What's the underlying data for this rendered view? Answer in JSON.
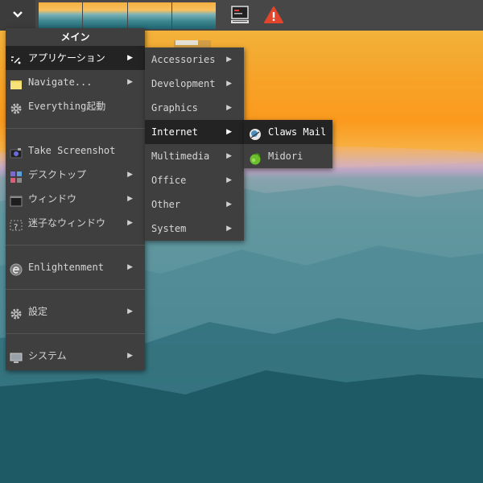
{
  "shelf": {
    "start_icon": "chevron-down-icon",
    "pager_desks": 4,
    "tray_icons": [
      "monitor-icon",
      "warning-icon"
    ]
  },
  "main_menu": {
    "title": "メイン",
    "items": [
      {
        "label": "アプリケーション",
        "icon": "applications-icon",
        "arrow": "▶"
      },
      {
        "label": "Navigate...",
        "icon": "folder-icon",
        "arrow": "▶"
      },
      {
        "label": "Everything起動",
        "icon": "gear-icon"
      },
      {
        "label": "Take Screenshot",
        "icon": "camera-icon"
      },
      {
        "label": "デスクトップ",
        "icon": "desktop-icon",
        "arrow": "▶"
      },
      {
        "label": "ウィンドウ",
        "icon": "window-icon",
        "arrow": "▶"
      },
      {
        "label": "迷子なウィンドウ",
        "icon": "lost-window-icon",
        "arrow": "▶"
      },
      {
        "label": "Enlightenment",
        "icon": "enlightenment-icon",
        "arrow": "▶"
      },
      {
        "label": "設定",
        "icon": "settings-gear-icon",
        "arrow": "▶"
      },
      {
        "label": "システム",
        "icon": "computer-icon",
        "arrow": "▶"
      }
    ]
  },
  "apps_menu": {
    "items": [
      {
        "label": "Accessories",
        "arrow": "▶"
      },
      {
        "label": "Development",
        "arrow": "▶"
      },
      {
        "label": "Graphics",
        "arrow": "▶"
      },
      {
        "label": "Internet",
        "arrow": "▶"
      },
      {
        "label": "Multimedia",
        "arrow": "▶"
      },
      {
        "label": "Office",
        "arrow": "▶"
      },
      {
        "label": "Other",
        "arrow": "▶"
      },
      {
        "label": "System",
        "arrow": "▶"
      }
    ]
  },
  "internet_menu": {
    "items": [
      {
        "label": "Claws Mail",
        "icon": "claws-mail-icon"
      },
      {
        "label": "Midori",
        "icon": "midori-icon"
      }
    ]
  },
  "colors": {
    "menu_bg": "#3f3f3f",
    "menu_selected": "#232323",
    "shelf_bg": "#474747"
  }
}
